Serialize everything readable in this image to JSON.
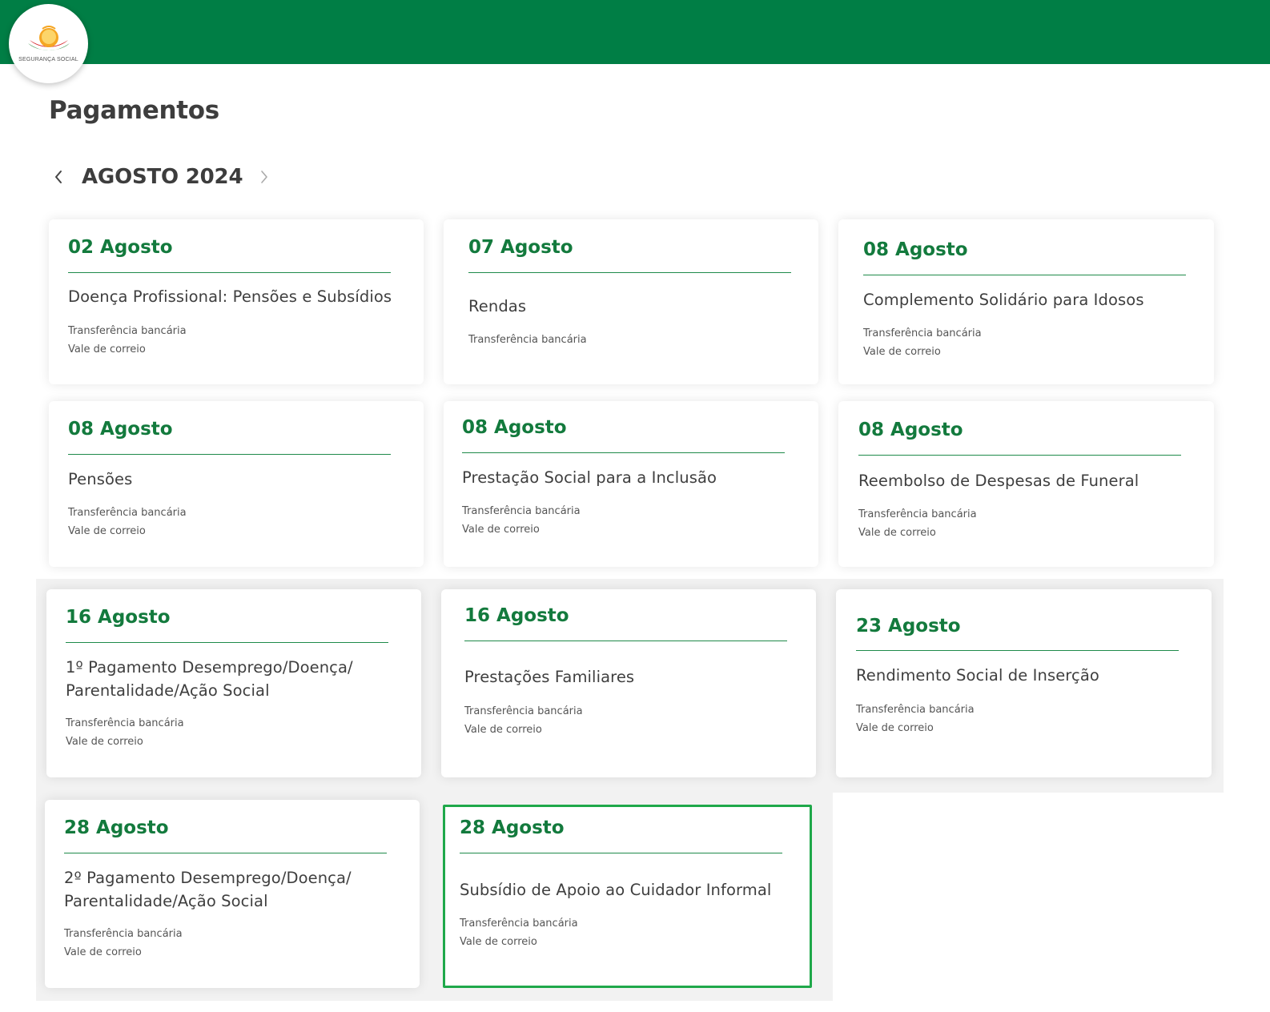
{
  "header": {
    "logo_text": "SEGURANÇA SOCIAL",
    "brand_color": "#007e45",
    "accent_color": "#137a3d"
  },
  "page": {
    "title": "Pagamentos",
    "month": "AGOSTO 2024",
    "prev_icon": "chevron-left-icon",
    "next_icon": "chevron-right-icon"
  },
  "cards": [
    {
      "date": "02 Agosto",
      "title": "Doença Profissional: Pensões e Subsídios",
      "methods": [
        "Transferência bancária",
        "Vale de correio"
      ]
    },
    {
      "date": "07 Agosto",
      "title": "Rendas",
      "methods": [
        "Transferência bancária"
      ]
    },
    {
      "date": "08 Agosto",
      "title": "Complemento Solidário para Idosos",
      "methods": [
        "Transferência bancária",
        "Vale de correio"
      ]
    },
    {
      "date": "08 Agosto",
      "title": "Pensões",
      "methods": [
        "Transferência bancária",
        "Vale de correio"
      ]
    },
    {
      "date": "08 Agosto",
      "title": "Prestação Social para a Inclusão",
      "methods": [
        "Transferência bancária",
        "Vale de correio"
      ]
    },
    {
      "date": "08 Agosto",
      "title": "Reembolso de Despesas de Funeral",
      "methods": [
        "Transferência bancária",
        "Vale de correio"
      ]
    },
    {
      "date": "16 Agosto",
      "title": "1º Pagamento Desemprego/Doença/ Parentalidade/Ação Social",
      "methods": [
        "Transferência bancária",
        "Vale de correio"
      ]
    },
    {
      "date": "16 Agosto",
      "title": "Prestações Familiares",
      "methods": [
        "Transferência bancária",
        "Vale de correio"
      ]
    },
    {
      "date": "23 Agosto",
      "title": "Rendimento Social de Inserção",
      "methods": [
        "Transferência bancária",
        "Vale de correio"
      ]
    },
    {
      "date": "28 Agosto",
      "title": "2º Pagamento Desemprego/Doença/ Parentalidade/Ação Social",
      "methods": [
        "Transferência bancária",
        "Vale de correio"
      ]
    },
    {
      "date": "28 Agosto",
      "title": "Subsídio de Apoio ao Cuidador Informal",
      "methods": [
        "Transferência bancária",
        "Vale de correio"
      ]
    }
  ]
}
